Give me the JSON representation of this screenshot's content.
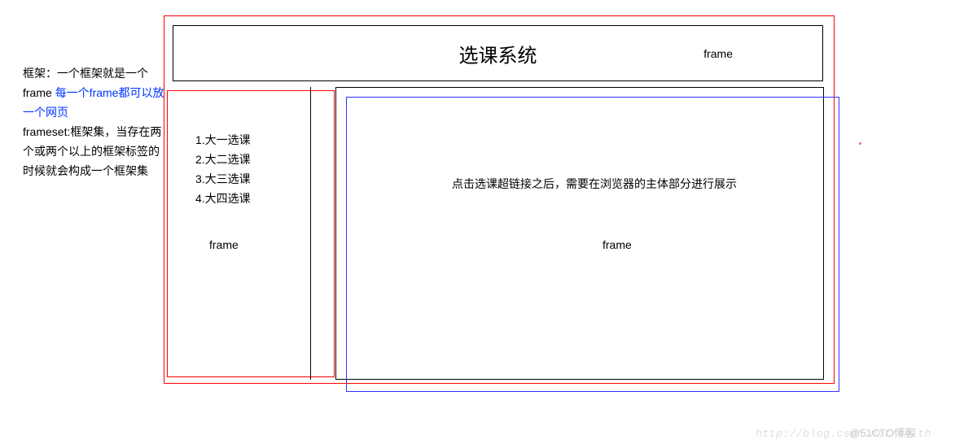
{
  "notes": {
    "line1a": "框架：一个框架就是一个",
    "line1b": "frame",
    "line2_blue": "每一个frame都可以放一个网页",
    "line3": "frameset:框架集，当存在两个或两个以上的框架标签的时候就会构成一个框架集"
  },
  "header": {
    "title": "选课系统",
    "frame_label": "frame"
  },
  "left_menu": {
    "items": [
      "1.大一选课",
      "2.大二选课",
      "3.大三选课",
      "4.大四选课"
    ],
    "frame_label": "frame"
  },
  "main": {
    "body_text": "点击选课超链接之后，需要在浏览器的主体部分进行展示",
    "frame_label": "frame"
  },
  "watermark": {
    "url": "http://blog.csdn.net/smith",
    "badge": "@51CTO博客"
  }
}
